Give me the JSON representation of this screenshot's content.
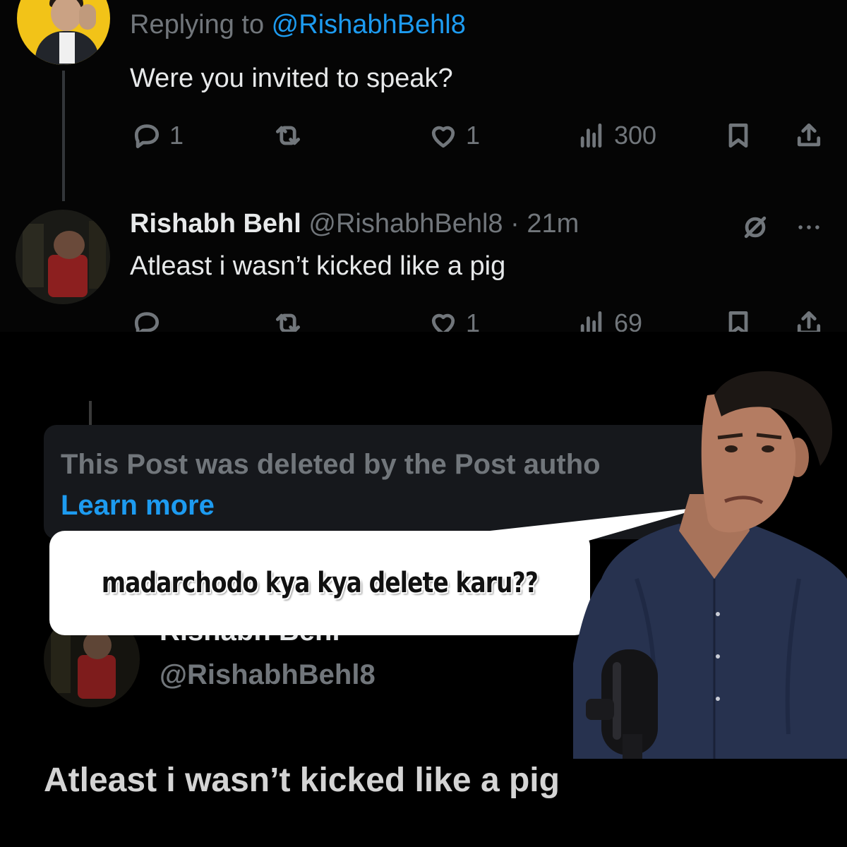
{
  "reply_tweet": {
    "replying_prefix": "Replying to ",
    "replying_handle": "@RishabhBehl8",
    "text": "Were you invited to speak?",
    "replies": "1",
    "likes": "1",
    "views": "300"
  },
  "rishabh_tweet": {
    "name": "Rishabh Behl",
    "handle_time": "@RishabhBehl8 · 21m",
    "text": "Atleast i wasn’t kicked like a pig",
    "likes": "1",
    "views": "69"
  },
  "deleted_notice": {
    "text": "This Post was deleted by the Post autho",
    "link": "Learn more"
  },
  "quoted_card": {
    "name": "Rishabh Behl",
    "handle": "@RishabhBehl8",
    "text": "Atleast i wasn’t kicked like a pig"
  },
  "speech_bubble": {
    "text": "madarchodo kya kya delete karu??"
  },
  "colors": {
    "accent": "#1d9bf0",
    "muted": "#71767b",
    "background": "#000000"
  },
  "icons": [
    "reply-icon",
    "retweet-icon",
    "like-icon",
    "views-icon",
    "bookmark-icon",
    "share-icon",
    "mute-icon",
    "more-icon"
  ]
}
